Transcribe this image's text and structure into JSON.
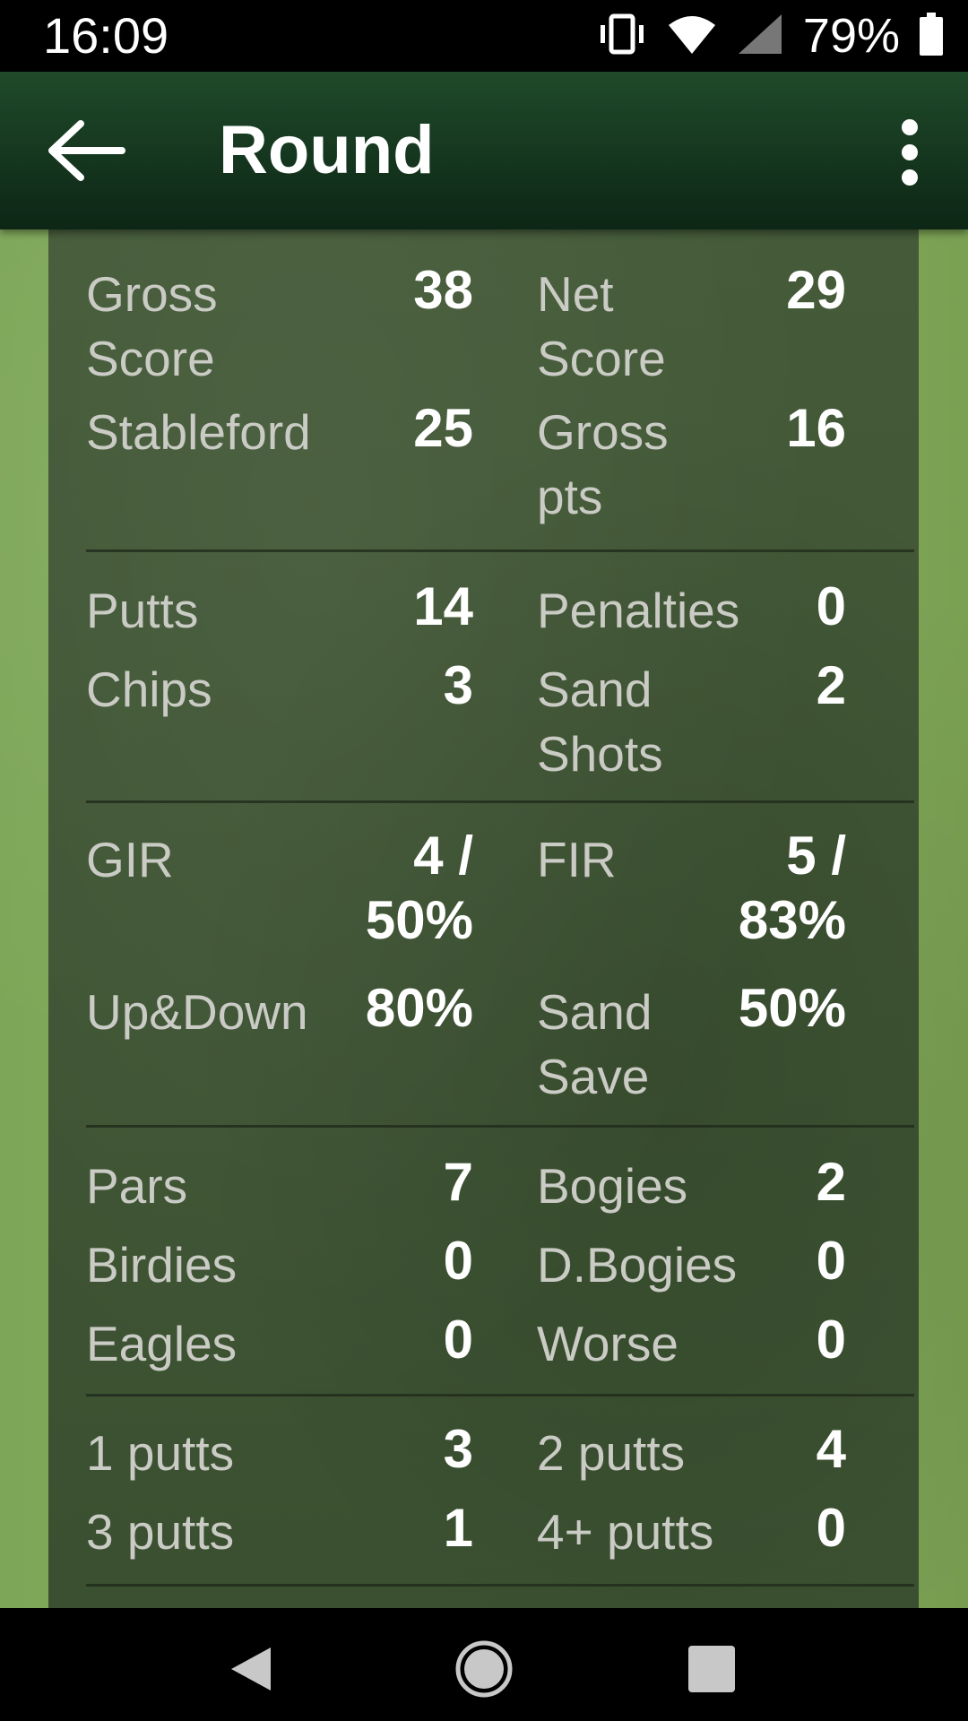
{
  "status_bar": {
    "time": "16:09",
    "battery": "79%",
    "icons": [
      "vibrate-icon",
      "wifi-icon",
      "signal-icon",
      "battery-icon"
    ]
  },
  "app_bar": {
    "title": "Round",
    "back_icon": "arrow-back-icon",
    "menu_icon": "more-vert-icon"
  },
  "stats": {
    "gross_score": {
      "label": "Gross Score",
      "value": "38"
    },
    "net_score": {
      "label": "Net Score",
      "value": "29"
    },
    "stableford": {
      "label": "Stableford",
      "value": "25"
    },
    "gross_pts": {
      "label": "Gross pts",
      "value": "16"
    },
    "putts": {
      "label": "Putts",
      "value": "14"
    },
    "penalties": {
      "label": "Penalties",
      "value": "0"
    },
    "chips": {
      "label": "Chips",
      "value": "3"
    },
    "sand_shots": {
      "label": "Sand Shots",
      "value": "2"
    },
    "gir": {
      "label": "GIR",
      "value": "4 / 50%"
    },
    "fir": {
      "label": "FIR",
      "value": "5 / 83%"
    },
    "up_down": {
      "label": "Up&Down",
      "value": "80%"
    },
    "sand_save": {
      "label": "Sand Save",
      "value": "50%"
    },
    "pars": {
      "label": "Pars",
      "value": "7"
    },
    "bogies": {
      "label": "Bogies",
      "value": "2"
    },
    "birdies": {
      "label": "Birdies",
      "value": "0"
    },
    "d_bogies": {
      "label": "D.Bogies",
      "value": "0"
    },
    "eagles": {
      "label": "Eagles",
      "value": "0"
    },
    "worse": {
      "label": "Worse",
      "value": "0"
    },
    "one_putts": {
      "label": "1 putts",
      "value": "3"
    },
    "two_putts": {
      "label": "2 putts",
      "value": "4"
    },
    "three_putts": {
      "label": "3 putts",
      "value": "1"
    },
    "four_plus_putts": {
      "label": "4+ putts",
      "value": "0"
    }
  },
  "nav_bar": {
    "icons": [
      "nav-back-icon",
      "nav-home-icon",
      "nav-recents-icon"
    ]
  }
}
